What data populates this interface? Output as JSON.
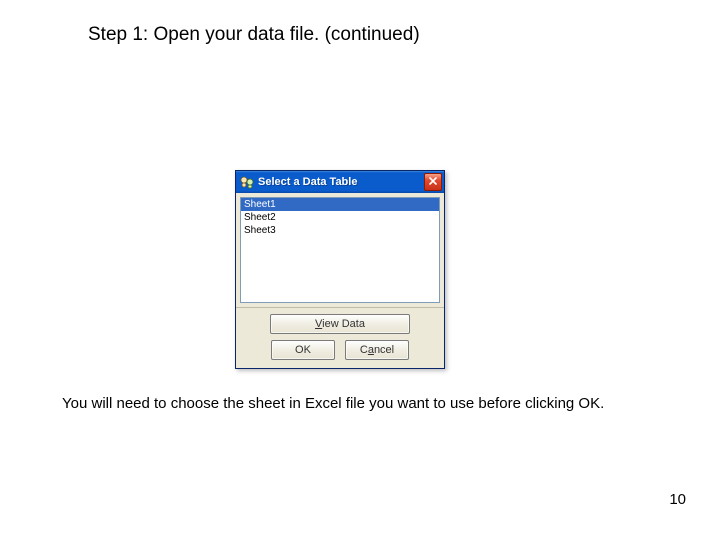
{
  "title": "Step 1: Open your data file. (continued)",
  "caption": "You will need to choose the sheet in Excel file you want to use before clicking OK.",
  "page_number": "10",
  "dialog": {
    "title": "Select a Data Table",
    "items": [
      "Sheet1",
      "Sheet2",
      "Sheet3"
    ],
    "selected_index": 0,
    "buttons": {
      "view_label": "View Data",
      "view_mnemonic": "V",
      "ok_label": "OK",
      "cancel_label": "Cancel",
      "cancel_mnemonic": "a"
    }
  }
}
